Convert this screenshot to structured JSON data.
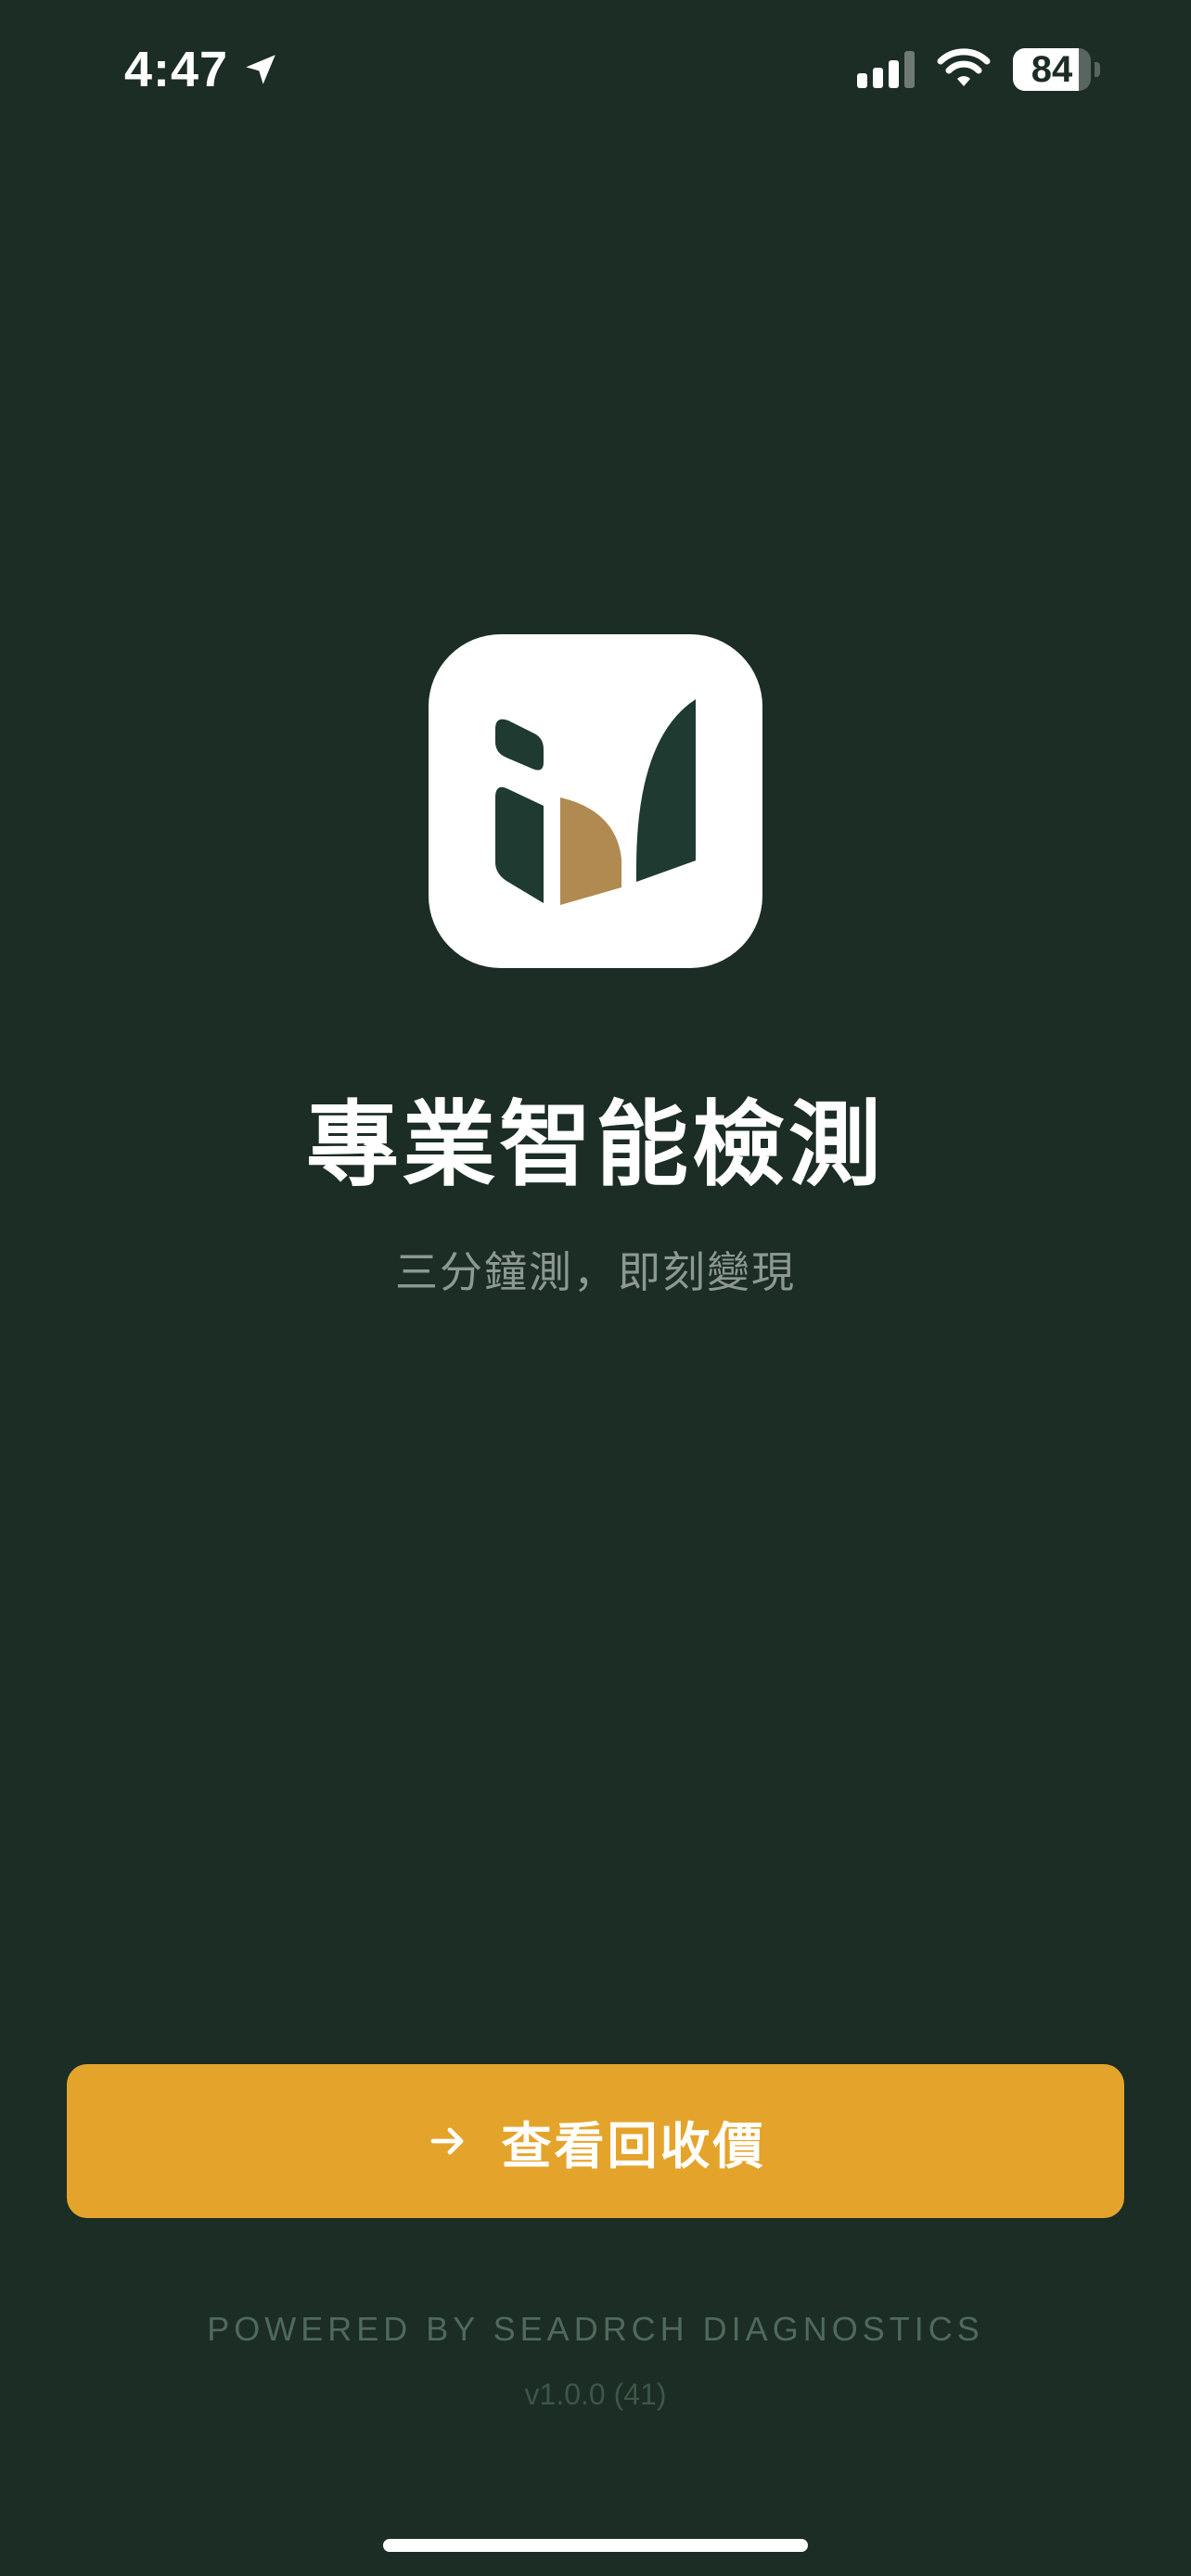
{
  "status_bar": {
    "time": "4:47",
    "battery": "84",
    "battery_level": 0.84,
    "icons": [
      "location-arrow-icon",
      "signal-icon",
      "wifi-icon",
      "battery-icon"
    ]
  },
  "logo": {
    "icon": "app-logo-icon",
    "colors": {
      "background": "#ffffff",
      "dark": "#1f3a30",
      "gold": "#b08a50"
    }
  },
  "main": {
    "title": "專業智能檢測",
    "subtitle": "三分鐘測，即刻變現"
  },
  "cta": {
    "label": "查看回收價",
    "icon": "arrow-right-icon"
  },
  "footer": {
    "powered_by": "POWERED BY SEADRCH DIAGNOSTICS",
    "version": "v1.0.0 (41)"
  },
  "colors": {
    "background": "#1b2d24",
    "accent": "#e4a42b",
    "subtitle": "#8d9891",
    "footer": "#4f6a5c"
  }
}
